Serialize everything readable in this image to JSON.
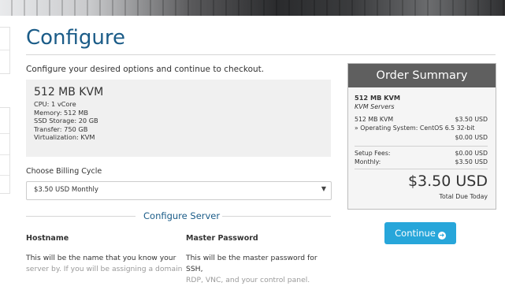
{
  "page": {
    "title": "Configure",
    "intro": "Configure your desired options and continue to checkout."
  },
  "product": {
    "name": "512 MB KVM",
    "specs": [
      "CPU: 1 vCore",
      "Memory: 512 MB",
      "SSD Storage: 20 GB",
      "Transfer: 750 GB",
      "Virtualization: KVM"
    ]
  },
  "billing": {
    "label": "Choose Billing Cycle",
    "selected": "$3.50 USD Monthly"
  },
  "configure_server": {
    "title": "Configure Server",
    "hostname_label": "Hostname",
    "hostname_desc_1": "This will be the name that you know your",
    "hostname_desc_2": "server by. If you will be assigning a domain",
    "password_label": "Master Password",
    "password_desc_1": "This will be the master password for SSH,",
    "password_desc_2": "RDP, VNC, and your control panel."
  },
  "summary": {
    "header": "Order Summary",
    "product": "512 MB KVM",
    "group": "KVM Servers",
    "line_label": "512 MB KVM",
    "line_price": "$3.50 USD",
    "os_label": "» Operating System: CentOS 6.5 32-bit",
    "os_price": "$0.00 USD",
    "setup_label": "Setup Fees:",
    "setup_price": "$0.00 USD",
    "monthly_label": "Monthly:",
    "monthly_price": "$3.50 USD",
    "total": "$3.50 USD",
    "total_label": "Total Due Today"
  },
  "actions": {
    "continue_label": "Continue"
  },
  "colors": {
    "title": "#1b5c88",
    "button": "#27a6da",
    "summary_header": "#5f5f5f"
  }
}
